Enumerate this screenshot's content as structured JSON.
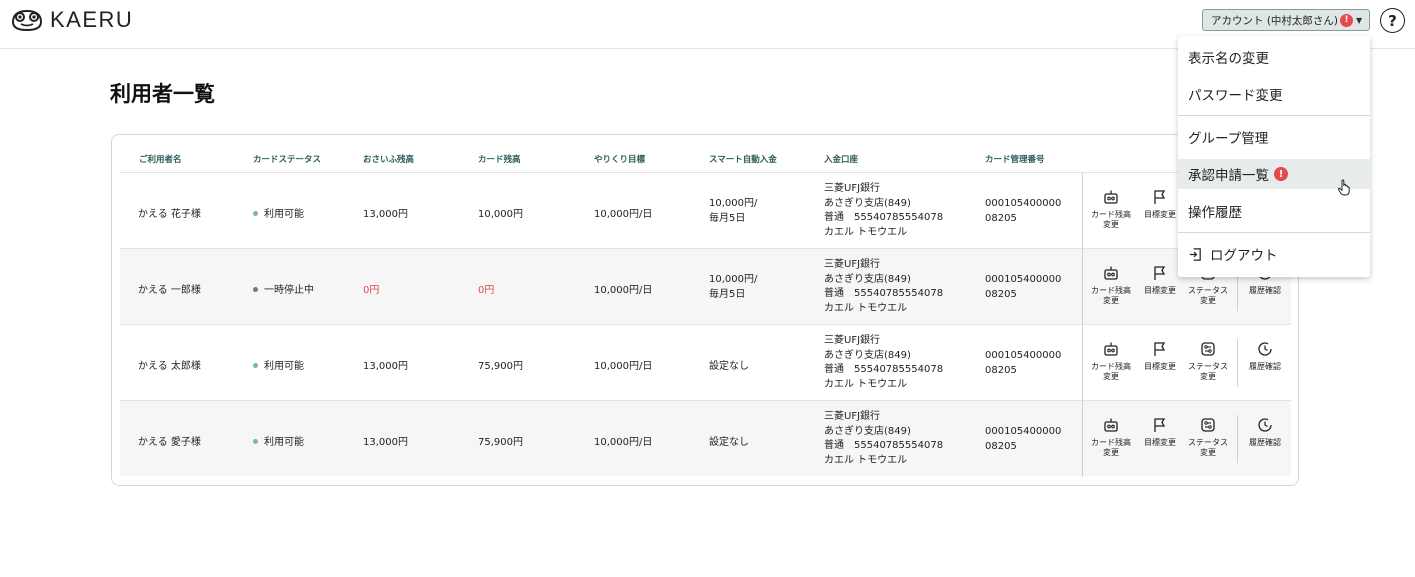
{
  "header": {
    "logo_text": "KAERU",
    "account_label": "アカウント (中村太郎さん)",
    "account_badge": "!",
    "help_label": "?"
  },
  "page": {
    "title": "利用者一覧"
  },
  "table": {
    "columns": [
      "ご利用者名",
      "カードステータス",
      "おさいふ残高",
      "カード残高",
      "やりくり目標",
      "スマート自動入金",
      "入金口座",
      "カード管理番号"
    ],
    "rows": [
      {
        "name": "かえる 花子様",
        "status": "利用可能",
        "wallet": "13,000円",
        "card": "10,000円",
        "goal": "10,000円/日",
        "auto_line1": "10,000円/",
        "auto_line2": "毎月5日",
        "bank_line1": "三菱UFJ銀行",
        "bank_line2": "あさぎり支店(849)",
        "bank_line3": "普通　55540785554078",
        "bank_line4": "カエル トモウエル",
        "card_no_line1": "000105400000",
        "card_no_line2": "08205"
      },
      {
        "name": "かえる 一郎様",
        "status": "一時停止中",
        "wallet": "0円",
        "card": "0円",
        "goal": "10,000円/日",
        "auto_line1": "10,000円/",
        "auto_line2": "毎月5日",
        "bank_line1": "三菱UFJ銀行",
        "bank_line2": "あさぎり支店(849)",
        "bank_line3": "普通　55540785554078",
        "bank_line4": "カエル トモウエル",
        "card_no_line1": "000105400000",
        "card_no_line2": "08205"
      },
      {
        "name": "かえる 太郎様",
        "status": "利用可能",
        "wallet": "13,000円",
        "card": "75,900円",
        "goal": "10,000円/日",
        "auto_line1": "設定なし",
        "auto_line2": "",
        "bank_line1": "三菱UFJ銀行",
        "bank_line2": "あさぎり支店(849)",
        "bank_line3": "普通　55540785554078",
        "bank_line4": "カエル トモウエル",
        "card_no_line1": "000105400000",
        "card_no_line2": "08205"
      },
      {
        "name": "かえる 愛子様",
        "status": "利用可能",
        "wallet": "13,000円",
        "card": "75,900円",
        "goal": "10,000円/日",
        "auto_line1": "設定なし",
        "auto_line2": "",
        "bank_line1": "三菱UFJ銀行",
        "bank_line2": "あさぎり支店(849)",
        "bank_line3": "普通　55540785554078",
        "bank_line4": "カエル トモウエル",
        "card_no_line1": "000105400000",
        "card_no_line2": "08205"
      }
    ],
    "actions": {
      "card_balance_line1": "カード残高",
      "card_balance_line2": "変更",
      "goal": "目標変更",
      "status_line1": "ステータス",
      "status_line2": "変更",
      "history": "履歴確認"
    }
  },
  "menu": {
    "items": [
      "表示名の変更",
      "パスワード変更",
      "グループ管理",
      "承認申請一覧",
      "操作履歴",
      "ログアウト"
    ],
    "badge": "!"
  },
  "colors": {
    "accent_teal": "#2e5c5a",
    "alert_red": "#e5484d",
    "status_green": "#7bb8a4"
  }
}
